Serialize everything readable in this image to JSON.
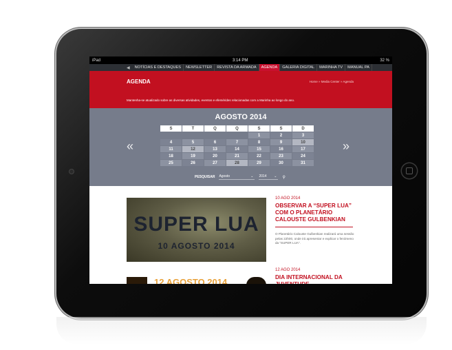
{
  "status_bar": {
    "carrier": "iPad",
    "time": "3:14 PM",
    "battery": "32 %"
  },
  "nav": {
    "items": [
      {
        "label": "NOTÍCIAS E DESTAQUES",
        "active": false
      },
      {
        "label": "NEWSLETTER",
        "active": false
      },
      {
        "label": "REVISTA DA ARMADA",
        "active": false
      },
      {
        "label": "AGENDA",
        "active": true
      },
      {
        "label": "GALERIA DIGITAL",
        "active": false
      },
      {
        "label": "MARINHA TV",
        "active": false
      },
      {
        "label": "MANUAL PA",
        "active": false
      }
    ]
  },
  "header": {
    "title": "AGENDA",
    "breadcrumb": "Home » Media Center » Agenda",
    "description": "Mantenha-se atualizado sobre as diversas atividades, eventos e efemérides relacionadas com a Marinha ao longo do ano."
  },
  "calendar": {
    "month_title": "AGOSTO 2014",
    "weekdays": [
      "S",
      "T",
      "Q",
      "Q",
      "S",
      "S",
      "D"
    ],
    "weeks": [
      [
        "",
        "",
        "",
        "",
        "1",
        "2",
        "3"
      ],
      [
        "4",
        "5",
        "6",
        "7",
        "8",
        "9",
        "10"
      ],
      [
        "11",
        "12",
        "13",
        "14",
        "15",
        "16",
        "17"
      ],
      [
        "18",
        "19",
        "20",
        "21",
        "22",
        "23",
        "24"
      ],
      [
        "25",
        "26",
        "27",
        "28",
        "29",
        "30",
        "31"
      ]
    ],
    "highlighted_days": [
      "10",
      "12",
      "28"
    ],
    "search_label": "PESQUISAR",
    "month_value": "Agosto",
    "year_value": "2014"
  },
  "articles": [
    {
      "image_line1": "SUPER LUA",
      "image_line2": "10 AGOSTO 2014",
      "date": "10 AGO 2014",
      "title": "OBSERVAR A “SUPER LUA” COM O PLANETÁRIO CALOUSTE GULBENKIAN",
      "body": "O Planetário Calouste Gulbenkian realizará uma sessão pelas 22h00, onde irá apresentar e explicar o fenómeno da “SUPER LUA”."
    },
    {
      "image_line1": "12 AGOSTO 2014",
      "date": "12 AGO 2014",
      "title": "DIA INTERNACIONAL DA JUVENTUDE"
    }
  ]
}
